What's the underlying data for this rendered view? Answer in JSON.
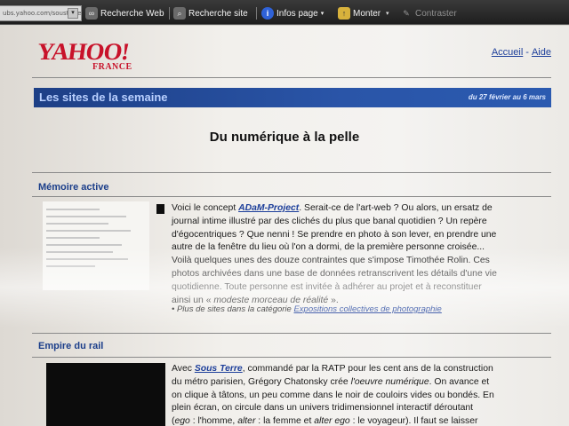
{
  "toolbar": {
    "url_text": "ubs.yahoo.com/sousterre",
    "items": [
      {
        "label": "Recherche Web",
        "icon": "binoculars-icon"
      },
      {
        "label": "Recherche site",
        "icon": "magnifier-icon"
      },
      {
        "label": "Infos page",
        "icon": "info-icon"
      },
      {
        "label": "Monter",
        "icon": "folder-up-icon"
      },
      {
        "label": "Contraster",
        "icon": "pen-icon",
        "disabled": true
      }
    ]
  },
  "header": {
    "logo_main": "YAHOO!",
    "logo_sub": "FRANCE",
    "links": [
      "Accueil",
      "Aide"
    ],
    "link_separator": "-"
  },
  "banner": {
    "title": "Les sites de la semaine",
    "date": "du 27 février au 6 mars"
  },
  "main_title": "Du numérique à la pelle",
  "sections": [
    {
      "title": "Mémoire active",
      "paragraph_lines": [
        [
          "Voici le concept ",
          {
            "link": "ADaM-Project"
          },
          ". Serait-ce de l'art-web ? Ou alors, un ersatz de"
        ],
        [
          "journal intime illustré par des clichés du plus que banal quotidien ? Un repère"
        ],
        [
          "d'égocentriques ? Que nenni ! Se prendre en photo à son lever, en prendre une"
        ],
        [
          "autre de la fenêtre du lieu où l'on a dormi, de la première personne croisée..."
        ],
        [
          "Voilà quelques unes des douze contraintes que s'impose Timothée Rolin. Ces"
        ],
        [
          "photos archivées dans une base de données retranscrivent les détails d'une vie"
        ],
        [
          "quotidienne. Toute personne est invitée à adhérer au projet et à reconstituer"
        ],
        [
          "ainsi un « ",
          {
            "italic": "modeste morceau de réalité"
          },
          " »."
        ]
      ],
      "more_prefix": "• Plus de sites dans la catégorie ",
      "more_link": "Expositions collectives de photographie"
    },
    {
      "title": "Empire du rail",
      "paragraph_lines": [
        [
          "Avec ",
          {
            "link": "Sous Terre"
          },
          ", commandé par la RATP pour les cent ans de la construction"
        ],
        [
          "du métro parisien, Grégory Chatonsky crée ",
          {
            "italic": "l'oeuvre numérique"
          },
          ". On avance et"
        ],
        [
          "on clique à tâtons, un peu comme dans le noir de couloirs vides ou bondés. En"
        ],
        [
          "plein écran, on circule dans un univers tridimensionnel interactif déroutant"
        ],
        [
          "(",
          {
            "italic": "ego"
          },
          " : l'homme, ",
          {
            "italic": "alter"
          },
          " : la femme et ",
          {
            "italic": "alter ego"
          },
          " : le voyageur). Il faut se laisser"
        ]
      ]
    }
  ],
  "colors": {
    "logo_red": "#c8122a",
    "banner_blue": "#1d3f86",
    "link_blue": "#1c3e9a"
  }
}
